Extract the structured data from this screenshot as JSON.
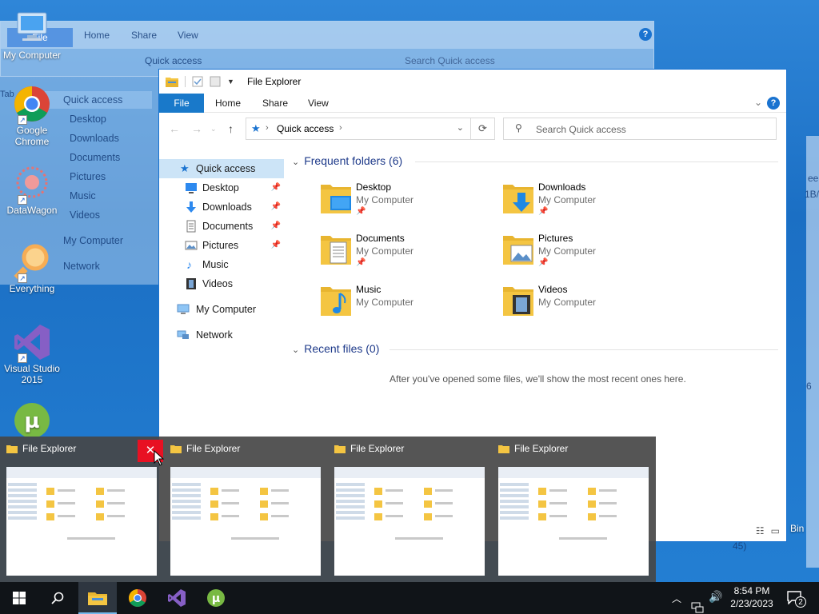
{
  "background_windows": {
    "ribbon_file": "File",
    "ribbon_home": "Home",
    "ribbon_share": "Share",
    "ribbon_view": "View",
    "address": "Quick access",
    "search_placeholder": "Search Quick access",
    "sidebar": [
      "Quick access",
      "Desktop",
      "Downloads",
      "Documents",
      "Pictures",
      "Music",
      "Videos",
      "My Computer",
      "Network"
    ],
    "right_frag_1": "ee",
    "right_frag_2": "1B/",
    "right_frag_3": "6",
    "right_frag_4": "Bin",
    "right_frag_5": "45)",
    "left_frag": "Tab"
  },
  "desktop_icons": [
    {
      "label": "My Computer",
      "icon": "computer-icon"
    },
    {
      "label": "Google Chrome",
      "icon": "chrome-icon"
    },
    {
      "label": "DataWagon",
      "icon": "datawagon-icon"
    },
    {
      "label": "Everything",
      "icon": "everything-icon"
    },
    {
      "label": "Visual Studio 2015",
      "icon": "visual-studio-icon"
    },
    {
      "label": "",
      "icon": "utorrent-icon"
    }
  ],
  "explorer": {
    "title": "File Explorer",
    "tabs": [
      "File",
      "Home",
      "Share",
      "View"
    ],
    "address_location": "Quick access",
    "search_placeholder": "Search Quick access",
    "help": "?",
    "sidebar": [
      {
        "label": "Quick access",
        "icon": "star-icon",
        "active": true,
        "pinned": false
      },
      {
        "label": "Desktop",
        "icon": "desktop-icon",
        "pinned": true
      },
      {
        "label": "Downloads",
        "icon": "download-icon",
        "pinned": true
      },
      {
        "label": "Documents",
        "icon": "documents-icon",
        "pinned": true
      },
      {
        "label": "Pictures",
        "icon": "pictures-icon",
        "pinned": true
      },
      {
        "label": "Music",
        "icon": "music-icon",
        "pinned": false
      },
      {
        "label": "Videos",
        "icon": "videos-icon",
        "pinned": false
      },
      {
        "label": "My Computer",
        "icon": "computer-icon",
        "pinned": false
      },
      {
        "label": "Network",
        "icon": "network-icon",
        "pinned": false
      }
    ],
    "frequent_header": "Frequent folders (6)",
    "folders": [
      {
        "name": "Desktop",
        "location": "My Computer",
        "pinned": true,
        "overlay": "desktop"
      },
      {
        "name": "Downloads",
        "location": "My Computer",
        "pinned": true,
        "overlay": "download"
      },
      {
        "name": "Documents",
        "location": "My Computer",
        "pinned": true,
        "overlay": "document"
      },
      {
        "name": "Pictures",
        "location": "My Computer",
        "pinned": true,
        "overlay": "picture"
      },
      {
        "name": "Music",
        "location": "My Computer",
        "pinned": false,
        "overlay": "music"
      },
      {
        "name": "Videos",
        "location": "My Computer",
        "pinned": false,
        "overlay": "video"
      }
    ],
    "recent_header": "Recent files (0)",
    "recent_empty": "After you've opened some files, we'll show the most recent ones here."
  },
  "thumbnails": [
    {
      "title": "File Explorer",
      "has_close": true
    },
    {
      "title": "File Explorer",
      "has_close": false
    },
    {
      "title": "File Explorer",
      "has_close": false
    },
    {
      "title": "File Explorer",
      "has_close": false
    }
  ],
  "taskbar": {
    "apps": [
      "start-icon",
      "search-icon",
      "file-explorer-icon",
      "chrome-icon",
      "visual-studio-icon",
      "utorrent-icon"
    ],
    "time": "8:54 PM",
    "date": "2/23/2023",
    "notification_count": "2"
  },
  "colors": {
    "accent": "#1979ca",
    "close_red": "#e81123",
    "taskbar": "#101418",
    "selected": "#cce4f7",
    "section_header": "#1e3a8a"
  }
}
